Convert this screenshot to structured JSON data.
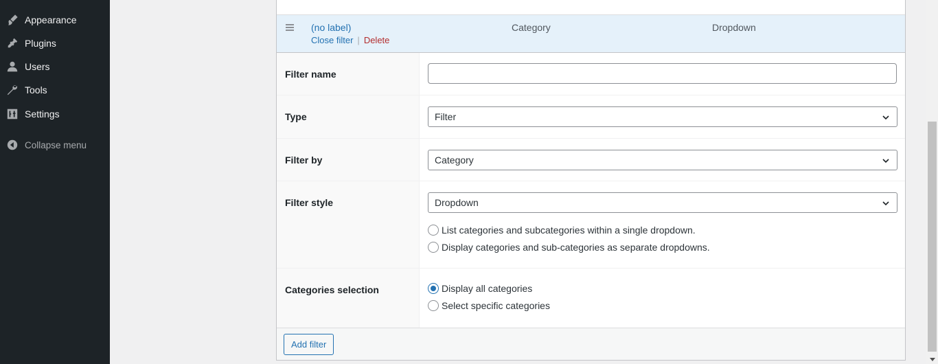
{
  "sidebar": {
    "items": [
      {
        "label": "Appearance",
        "icon": "paintbrush-icon"
      },
      {
        "label": "Plugins",
        "icon": "plugin-icon"
      },
      {
        "label": "Users",
        "icon": "user-icon"
      },
      {
        "label": "Tools",
        "icon": "wrench-icon"
      },
      {
        "label": "Settings",
        "icon": "settings-sliders-icon"
      }
    ],
    "collapse_label": "Collapse menu"
  },
  "filter": {
    "header": {
      "label": "(no label)",
      "close_label": "Close filter",
      "separator": "|",
      "delete_label": "Delete",
      "filter_by": "Category",
      "filter_style": "Dropdown"
    },
    "rows": {
      "filter_name": {
        "label": "Filter name",
        "value": ""
      },
      "type": {
        "label": "Type",
        "value": "Filter"
      },
      "filter_by": {
        "label": "Filter by",
        "value": "Category"
      },
      "filter_style": {
        "label": "Filter style",
        "value": "Dropdown",
        "options": [
          {
            "label": "List categories and subcategories within a single dropdown.",
            "checked": false
          },
          {
            "label": "Display categories and sub-categories as separate dropdowns.",
            "checked": false
          }
        ]
      },
      "categories_selection": {
        "label": "Categories selection",
        "options": [
          {
            "label": "Display all categories",
            "checked": true
          },
          {
            "label": "Select specific categories",
            "checked": false
          }
        ]
      }
    },
    "add_filter_label": "Add filter"
  },
  "colors": {
    "sidebar_bg": "#1d2327",
    "accent": "#2271b1",
    "delete": "#b32d2e",
    "header_bg": "#e5f1fa"
  }
}
